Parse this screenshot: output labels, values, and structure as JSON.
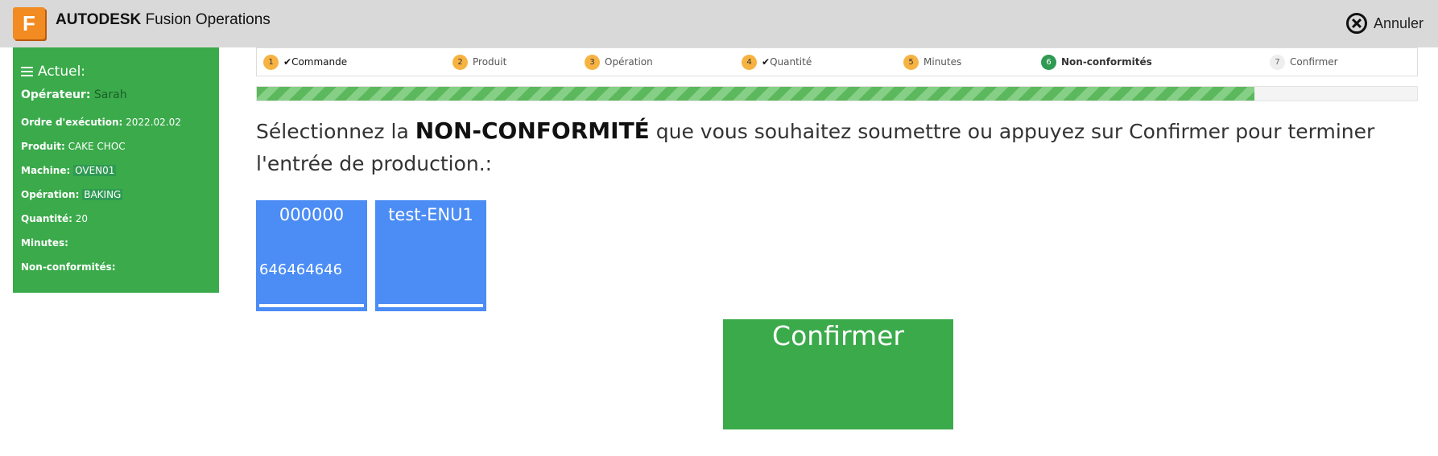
{
  "header": {
    "logo_letter": "F",
    "brand_bold": "AUTODESK",
    "brand_rest": "Fusion Operations",
    "cancel_label": "Annuler",
    "cancel_icon": "close-circle-icon"
  },
  "sidebar": {
    "title": "Actuel:",
    "menu_icon": "hamburger-icon",
    "rows": [
      {
        "label": "Opérateur:",
        "value": "Sarah"
      },
      {
        "label": "Ordre d'exécution:",
        "value": "2022.02.02"
      },
      {
        "label": "Produit:",
        "value": "CAKE CHOC"
      },
      {
        "label": "Machine:",
        "value": "OVEN01"
      },
      {
        "label": "Opération:",
        "value": "BAKING"
      },
      {
        "label": "Quantité:",
        "value": "20"
      },
      {
        "label": "Minutes:",
        "value": ""
      },
      {
        "label": "Non-conformités:",
        "value": ""
      }
    ]
  },
  "stepper": {
    "steps": [
      {
        "num": "1",
        "label": "Commande",
        "check": "✔"
      },
      {
        "num": "2",
        "label": "Produit"
      },
      {
        "num": "3",
        "label": "Opération"
      },
      {
        "num": "4",
        "label": "Quantité",
        "check": "✔"
      },
      {
        "num": "5",
        "label": "Minutes"
      },
      {
        "num": "6",
        "label": "Non-conformités"
      },
      {
        "num": "7",
        "label": "Confirmer"
      }
    ],
    "active_step": 6
  },
  "progress": {
    "percent": 86
  },
  "prompt": {
    "before": "Sélectionnez la ",
    "strong": "NON-CONFORMITÉ",
    "after": " que vous souhaitez soumettre ou appuyez sur Confirmer pour terminer l'entrée de production.:"
  },
  "tiles": [
    {
      "title": "000000",
      "subtitle": "646464646"
    },
    {
      "title": "test-ENU1",
      "subtitle": ""
    }
  ],
  "confirm_label": "Confirmer",
  "colors": {
    "green": "#3aaa4a",
    "blue": "#4b8cf5",
    "orange": "#f7b342",
    "header_bg": "#d9d9d9"
  }
}
